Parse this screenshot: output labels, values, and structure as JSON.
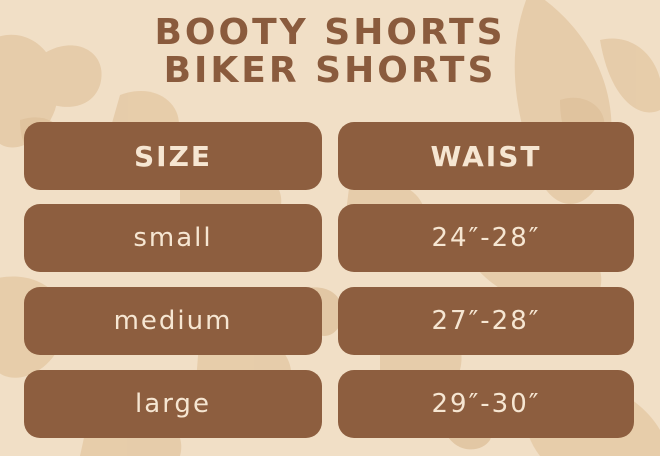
{
  "titles": [
    "BOOTY SHORTS",
    "BIKER SHORTS"
  ],
  "table": {
    "headers": [
      "SIZE",
      "WAIST"
    ],
    "rows": [
      [
        "small",
        "24″-28″"
      ],
      [
        "medium",
        "27″-28″"
      ],
      [
        "large",
        "29″-30″"
      ]
    ]
  },
  "colors": {
    "background": "#f1dfc6",
    "pill": "#8d5e3f",
    "title_text": "#8a5b3d",
    "pill_text": "#f6e6d2"
  }
}
